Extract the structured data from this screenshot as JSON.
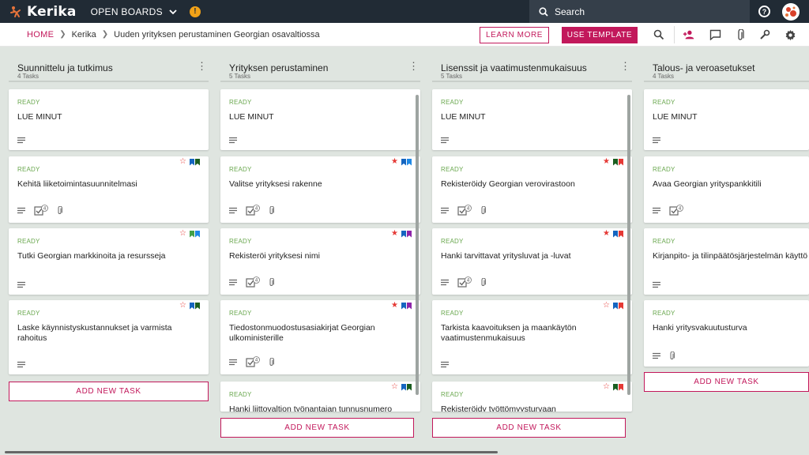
{
  "topbar": {
    "logo_text": "Kerika",
    "open_boards_label": "OPEN BOARDS",
    "alert_badge": "!",
    "search_placeholder": "Search"
  },
  "breadcrumb": {
    "home": "HOME",
    "board_owner": "Kerika",
    "board_name": "Uuden yrityksen perustaminen Georgian osavaltiossa"
  },
  "actions": {
    "learn_more": "LEARN MORE",
    "use_template": "USE TEMPLATE"
  },
  "colors": {
    "brand": "#c2185b",
    "ready": "#6aa84f",
    "star": "#e53935",
    "bm_blue": "#1565c0",
    "bm_lightblue": "#1e88e5",
    "bm_green": "#1b5e20",
    "bm_lightgreen": "#43a047",
    "bm_red": "#e53935",
    "bm_purple": "#8e24aa"
  },
  "columns": [
    {
      "title": "Suunnittelu ja tutkimus",
      "count": "4 Tasks",
      "add_label": "ADD NEW TASK",
      "cards": [
        {
          "status": "READY",
          "title": "LUE MINUT",
          "checklist": false,
          "check_count": "",
          "attachment": false,
          "star": "none",
          "bookmarks": []
        },
        {
          "status": "READY",
          "title": "Kehitä liiketoimintasuunnitelmasi",
          "checklist": true,
          "check_count": "4",
          "attachment": true,
          "star": "outline",
          "bookmarks": [
            "bm_blue",
            "bm_green"
          ]
        },
        {
          "status": "READY",
          "title": "Tutki Georgian markkinoita ja resursseja",
          "checklist": false,
          "check_count": "",
          "attachment": false,
          "star": "outline",
          "bookmarks": [
            "bm_lightgreen",
            "bm_lightblue"
          ]
        },
        {
          "status": "READY",
          "title": "Laske käynnistyskustannukset ja varmista rahoitus",
          "checklist": false,
          "check_count": "",
          "attachment": false,
          "star": "outline",
          "bookmarks": [
            "bm_blue",
            "bm_green"
          ]
        }
      ]
    },
    {
      "title": "Yrityksen perustaminen",
      "count": "5 Tasks",
      "add_label": "ADD NEW TASK",
      "cards": [
        {
          "status": "READY",
          "title": "LUE MINUT",
          "checklist": false,
          "check_count": "",
          "attachment": false,
          "star": "none",
          "bookmarks": []
        },
        {
          "status": "READY",
          "title": "Valitse yrityksesi rakenne",
          "checklist": true,
          "check_count": "4",
          "attachment": true,
          "star": "filled",
          "bookmarks": [
            "bm_blue",
            "bm_lightblue"
          ]
        },
        {
          "status": "READY",
          "title": "Rekisteröi yrityksesi nimi",
          "checklist": true,
          "check_count": "4",
          "attachment": true,
          "star": "filled",
          "bookmarks": [
            "bm_blue",
            "bm_purple"
          ]
        },
        {
          "status": "READY",
          "title": "Tiedostonmuodostusasiakirjat Georgian ulkoministerille",
          "checklist": true,
          "check_count": "4",
          "attachment": true,
          "star": "filled",
          "bookmarks": [
            "bm_blue",
            "bm_purple"
          ]
        },
        {
          "status": "READY",
          "title": "Hanki liittovaltion työnantajan tunnusnumero",
          "checklist": false,
          "check_count": "",
          "attachment": false,
          "star": "outline",
          "bookmarks": [
            "bm_blue",
            "bm_green"
          ]
        }
      ]
    },
    {
      "title": "Lisenssit ja vaatimustenmukaisuus",
      "count": "5 Tasks",
      "add_label": "ADD NEW TASK",
      "cards": [
        {
          "status": "READY",
          "title": "LUE MINUT",
          "checklist": false,
          "check_count": "",
          "attachment": false,
          "star": "none",
          "bookmarks": []
        },
        {
          "status": "READY",
          "title": "Rekisteröidy Georgian verovirastoon",
          "checklist": true,
          "check_count": "4",
          "attachment": true,
          "star": "filled",
          "bookmarks": [
            "bm_green",
            "bm_red"
          ]
        },
        {
          "status": "READY",
          "title": "Hanki tarvittavat yritysluvat ja -luvat",
          "checklist": true,
          "check_count": "4",
          "attachment": true,
          "star": "filled",
          "bookmarks": [
            "bm_blue",
            "bm_red"
          ]
        },
        {
          "status": "READY",
          "title": "Tarkista kaavoituksen ja maankäytön vaatimustenmukaisuus",
          "checklist": false,
          "check_count": "",
          "attachment": false,
          "star": "outline",
          "bookmarks": [
            "bm_blue",
            "bm_red"
          ]
        },
        {
          "status": "READY",
          "title": "Rekisteröidy työttömyysturvaan",
          "checklist": false,
          "check_count": "",
          "attachment": false,
          "star": "outline",
          "bookmarks": [
            "bm_green",
            "bm_red"
          ]
        }
      ]
    },
    {
      "title": "Talous- ja veroasetukset",
      "count": "4 Tasks",
      "add_label": "ADD NEW TASK",
      "cards": [
        {
          "status": "READY",
          "title": "LUE MINUT",
          "checklist": false,
          "check_count": "",
          "attachment": false,
          "star": "none",
          "bookmarks": []
        },
        {
          "status": "READY",
          "title": "Avaa Georgian yrityspankkitili",
          "checklist": true,
          "check_count": "4",
          "attachment": false,
          "star": "none",
          "bookmarks": []
        },
        {
          "status": "READY",
          "title": "Kirjanpito- ja tilinpäätösjärjestelmän käyttö",
          "checklist": false,
          "check_count": "",
          "attachment": false,
          "star": "none",
          "bookmarks": []
        },
        {
          "status": "READY",
          "title": "Hanki yritysvakuutusturva",
          "checklist": false,
          "check_count": "",
          "attachment": true,
          "star": "none",
          "bookmarks": []
        }
      ]
    }
  ]
}
